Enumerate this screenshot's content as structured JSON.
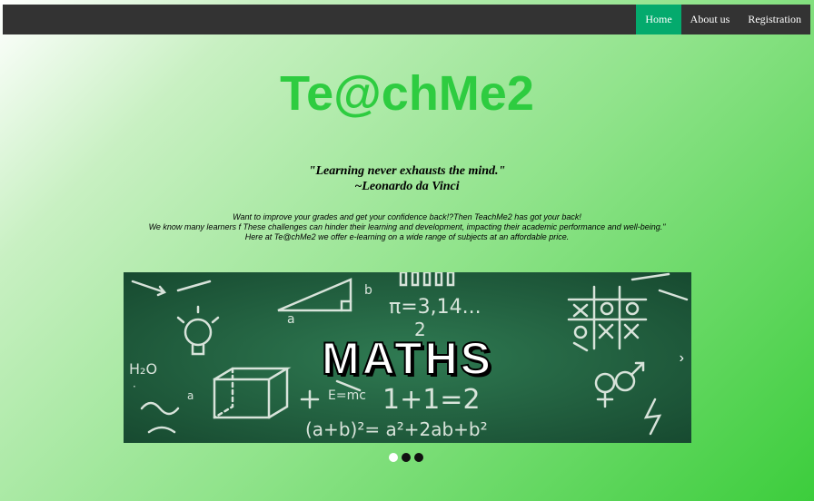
{
  "nav": {
    "items": [
      {
        "label": "Home",
        "active": true
      },
      {
        "label": "About us",
        "active": false
      },
      {
        "label": "Registration",
        "active": false
      }
    ],
    "active_color": "#04aa6d",
    "background": "#333333"
  },
  "header": {
    "title": "Te@chMe2",
    "title_color": "#2ecc40"
  },
  "quote": {
    "text": "\"Learning never exhausts the mind.\"",
    "author": "~Leonardo da Vinci"
  },
  "intro": {
    "lines": [
      "Want to improve your grades and get your confidence back!?Then TeachMe2 has got your back!",
      "We know many learners f These challenges can hinder their learning and development, impacting their academic performance and well-being.\"",
      "Here at Te@chMe2 we offer e-learning on a wide range of subjects at an affordable price."
    ]
  },
  "slideshow": {
    "caption": "MATHS",
    "next_icon": "chevron-right-icon",
    "dots": [
      {
        "active": true
      },
      {
        "active": false
      },
      {
        "active": false
      }
    ],
    "chalk_texts": {
      "pi": "π=3,14...",
      "one_plus_one": "1+1=2",
      "formula": "(a+b)²= a²+2ab+b²",
      "h2o": "H₂O",
      "emc": "E=mc"
    }
  }
}
